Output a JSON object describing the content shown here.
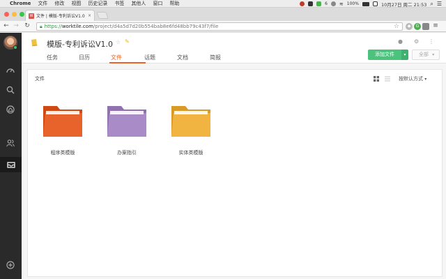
{
  "menubar": {
    "app": "Chrome",
    "items": [
      "文件",
      "修改",
      "视图",
      "历史记录",
      "书签",
      "其他人",
      "窗口",
      "帮助"
    ],
    "wechat_badge": "6",
    "battery": "100%",
    "clock": "10月27日 周二  21:53"
  },
  "browser": {
    "tab_title": "文件 | 模版-专利诉讼V1.0 - ...",
    "url_scheme": "https://",
    "url_host": "worktile.com",
    "url_path": "/project/d4a5d7d20b554bab8e6fd48bb79c43f7/file"
  },
  "project": {
    "title": "模版-专利诉讼V1.0",
    "tabs": [
      {
        "label": "任务"
      },
      {
        "label": "日历"
      },
      {
        "label": "文件",
        "active": true
      },
      {
        "label": "话题"
      },
      {
        "label": "文档"
      },
      {
        "label": "简报"
      }
    ],
    "add_file": "添加文件",
    "filter": "全部"
  },
  "files": {
    "heading": "文件",
    "sort_label": "按默认方式",
    "folders": [
      {
        "name": "程序类模版",
        "color": "#e8632b"
      },
      {
        "name": "办案指引",
        "color": "#a98bc7"
      },
      {
        "name": "实体类模版",
        "color": "#f2b441"
      }
    ]
  },
  "colors": {
    "accent": "#e8632b",
    "primary_button": "#4bc37d",
    "sidebar": "#2a2a2a"
  }
}
